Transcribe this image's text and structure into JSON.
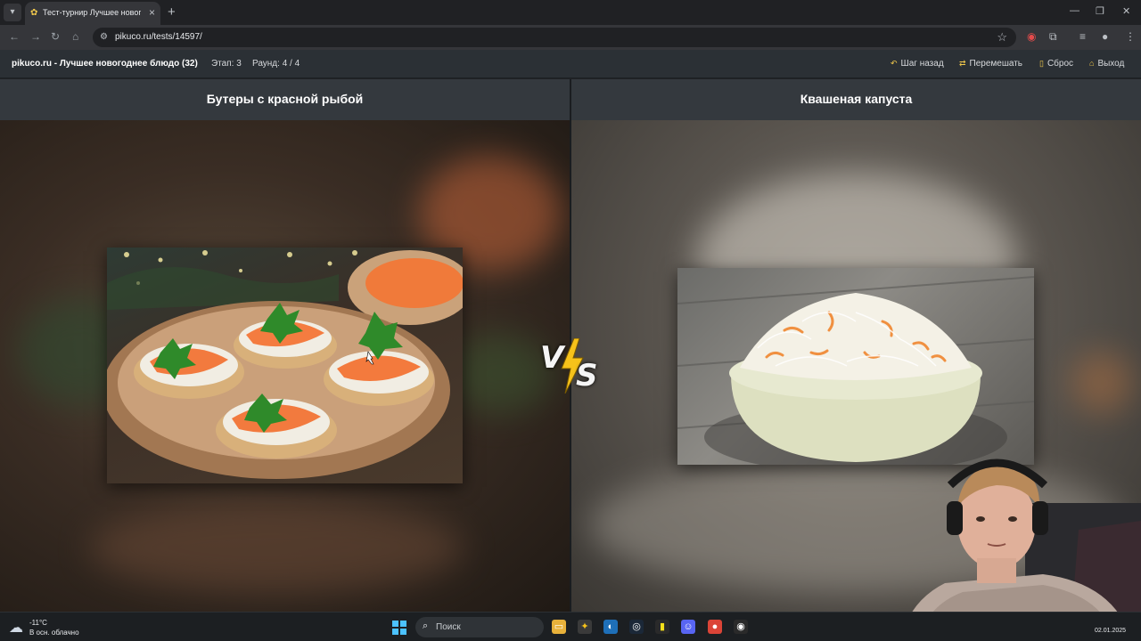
{
  "browser": {
    "tab_title": "Тест-турнир Лучшее новогод...",
    "url": "pikuco.ru/tests/14597/",
    "icons": [
      "menu-icon",
      "back-icon",
      "forward-icon",
      "reload-icon",
      "home-icon",
      "site-info-icon",
      "star-icon",
      "extension-icon",
      "profile-icon",
      "more-icon"
    ]
  },
  "site_header": {
    "title": "pikuco.ru - Лучшее новогоднее блюдо (32)",
    "stage": "Этап: 3",
    "round": "Раунд: 4 / 4",
    "actions": {
      "back": "Шаг назад",
      "shuffle": "Перемешать",
      "reset": "Сброс",
      "exit": "Выход"
    }
  },
  "matchup": {
    "left": {
      "title": "Бутеры с красной рыбой"
    },
    "right": {
      "title": "Квашеная капуста"
    },
    "vs": {
      "v": "V",
      "s": "S"
    }
  },
  "taskbar": {
    "weather_temp": "-11°C",
    "weather_desc": "В осн. облачно",
    "search_label": "Поиск",
    "clock_date": "02.01.2025"
  },
  "colors": {
    "accent": "#f2c94c",
    "header_bg": "#2b3035",
    "title_bar_bg": "#34393e"
  }
}
